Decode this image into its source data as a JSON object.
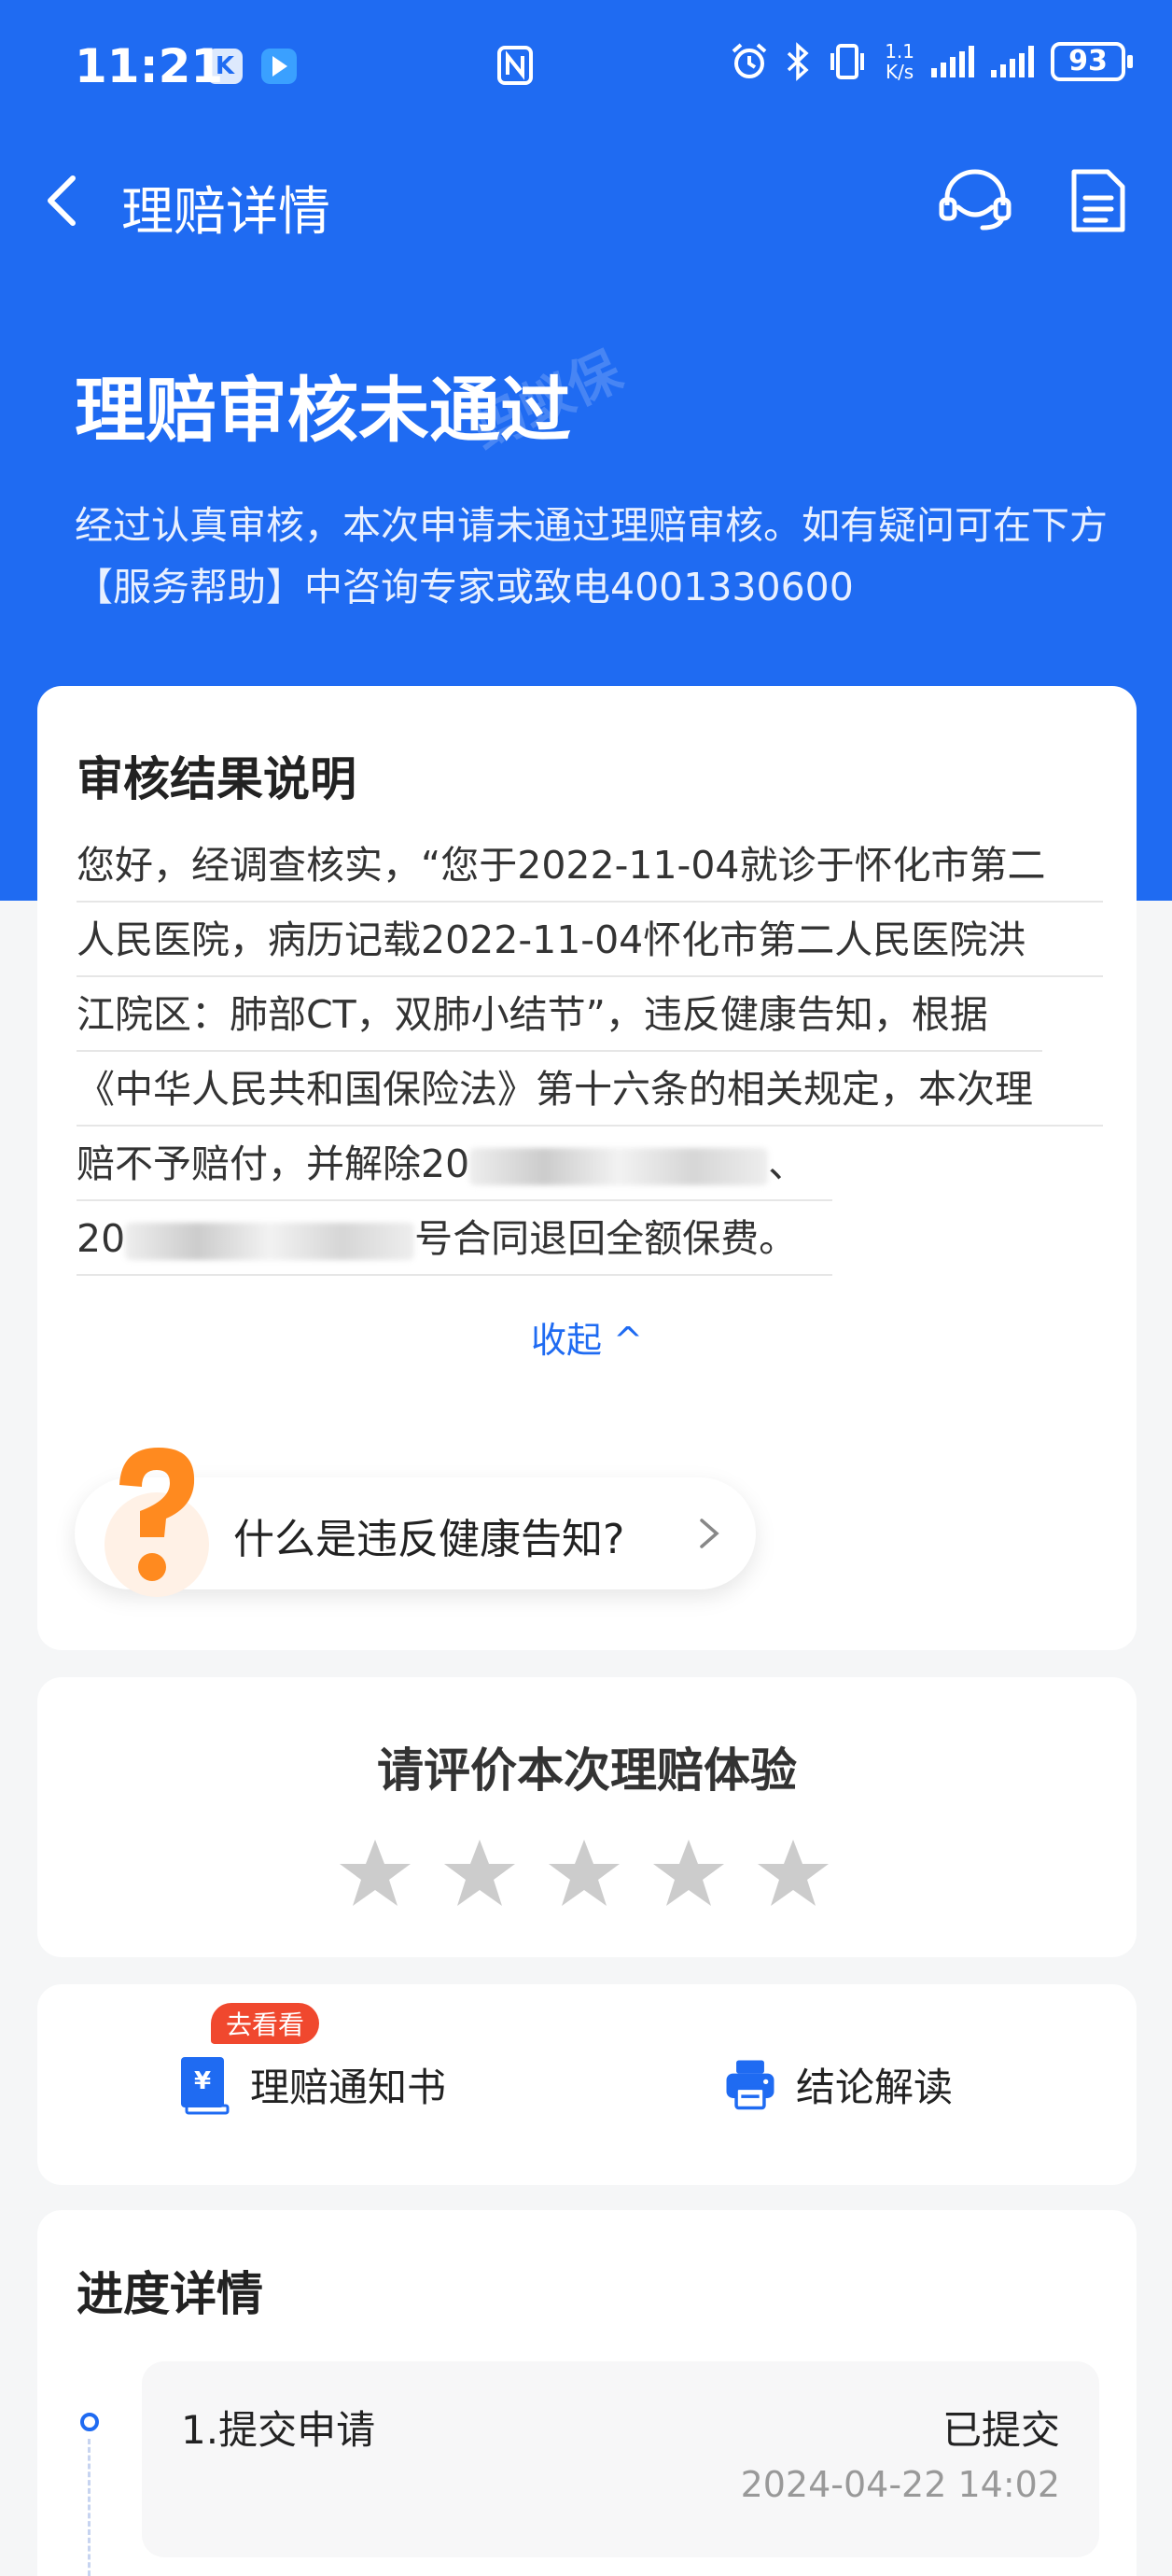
{
  "status_bar": {
    "time": "11:21",
    "app_k": "K",
    "net_speed_top": "1.1",
    "net_speed_bottom": "K/s",
    "battery": "93"
  },
  "nav": {
    "title": "理赔详情"
  },
  "header": {
    "headline": "理赔审核未通过",
    "watermark": "蚂蚁保",
    "subtitle": "经过认真审核，本次申请未通过理赔审核。如有疑问可在下方【服务帮助】中咨询专家或致电4001330600"
  },
  "result": {
    "title": "审核结果说明",
    "lines": [
      "您好，经调查核实，“您于2022-11-04就诊于怀化市第二",
      "人民医院，病历记载2022-11-04怀化市第二人民医院洪",
      "江院区：肺部CT，双肺小结节”，违反健康告知，根据",
      "《中华人民共和国保险法》第十六条的相关规定，本次理",
      "赔不予赔付，并解除20",
      "20",
      "号合同退回全额保费。"
    ],
    "line5_tail": "、",
    "collapse": "收起 ^",
    "faq": "什么是违反健康告知?"
  },
  "rating": {
    "title": "请评价本次理赔体验",
    "stars": 0,
    "max_stars": 5
  },
  "actions": {
    "badge": "去看看",
    "notice": "理赔通知书",
    "conclusion": "结论解读"
  },
  "progress": {
    "title": "进度详情",
    "steps": [
      {
        "name": "1.提交申请",
        "status": "已提交",
        "time": "2024-04-22 14:02"
      }
    ]
  },
  "colors": {
    "brand_blue": "#1f6bf2",
    "badge_red": "#f0482e"
  }
}
